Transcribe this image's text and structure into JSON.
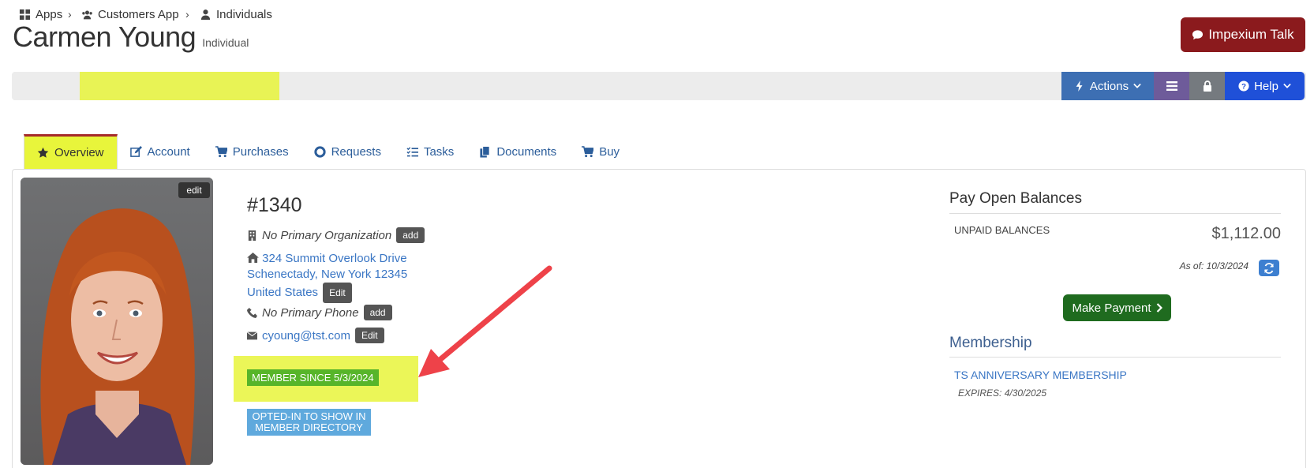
{
  "header": {
    "name": "Carmen Young",
    "type": "Individual",
    "talk_button": "Impexium Talk"
  },
  "breadcrumb": {
    "items": [
      {
        "label": "Apps",
        "icon": "grid-icon"
      },
      {
        "label": "Customers App",
        "icon": "users-icon"
      },
      {
        "label": "Individuals",
        "icon": "user-icon"
      }
    ]
  },
  "toolbar": {
    "actions_label": "Actions",
    "help_label": "Help"
  },
  "tabs": [
    {
      "label": "Overview",
      "icon": "star-icon",
      "active": true
    },
    {
      "label": "Account",
      "icon": "edit-icon"
    },
    {
      "label": "Purchases",
      "icon": "cart-icon"
    },
    {
      "label": "Requests",
      "icon": "lifebuoy-icon"
    },
    {
      "label": "Tasks",
      "icon": "checklist-icon"
    },
    {
      "label": "Documents",
      "icon": "documents-icon"
    },
    {
      "label": "Buy",
      "icon": "cart-icon"
    }
  ],
  "profile": {
    "photo_edit": "edit",
    "id": "#1340",
    "organization": "No Primary Organization",
    "org_add": "add",
    "address_line1": "324 Summit Overlook Drive",
    "address_line2": "Schenectady, New York 12345",
    "address_line3": "United States",
    "address_edit": "Edit",
    "phone": "No Primary Phone",
    "phone_add": "add",
    "email": "cyoung@tst.com",
    "email_edit": "Edit",
    "member_since": "MEMBER SINCE 5/3/2024",
    "opted_in": "OPTED-IN TO SHOW IN MEMBER DIRECTORY"
  },
  "balances": {
    "title": "Pay Open Balances",
    "label": "UNPAID BALANCES",
    "amount": "$1,112.00",
    "as_of": "As of: 10/3/2024",
    "pay_button": "Make Payment"
  },
  "membership": {
    "title": "Membership",
    "name": "TS ANNIVERSARY MEMBERSHIP",
    "expires": "EXPIRES: 4/30/2025"
  },
  "colors": {
    "highlight": "#e8f53b",
    "talk": "#8b1a1d",
    "actions": "#3d6fb3",
    "help": "#1f50d8",
    "member_badge": "#57b52a",
    "optin_badge": "#5fa9dd",
    "pay": "#1f6b1f",
    "arrow": "#ee4249"
  }
}
